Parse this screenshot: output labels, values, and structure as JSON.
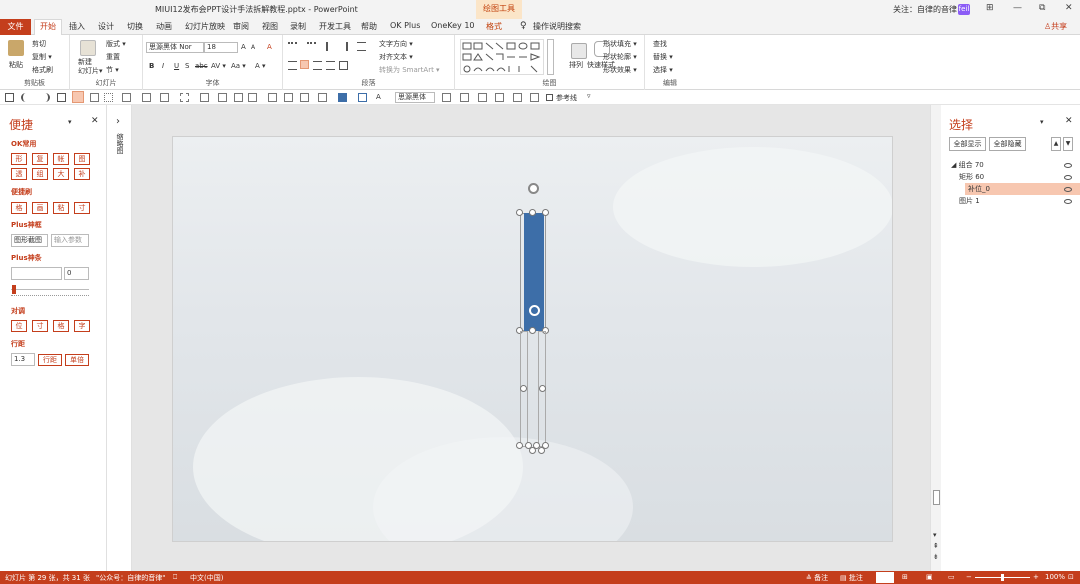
{
  "window": {
    "doc_title": "MIUI12发布会PPT设计手法拆解教程.pptx  -  PowerPoint",
    "context_tab_group": "绘图工具",
    "user": "关注：自律的音律",
    "user_badge": "feil",
    "minimize": "—",
    "restore": "⧉",
    "close": "✕",
    "ribbon_display": "⊞"
  },
  "tabs": {
    "file": "文件",
    "items": [
      "开始",
      "插入",
      "设计",
      "切换",
      "动画",
      "幻灯片放映",
      "审阅",
      "视图",
      "录制",
      "开发工具",
      "帮助",
      "OK Plus",
      "OneKey 10",
      "格式"
    ],
    "tell_me": "操作说明搜索",
    "share": "共享"
  },
  "ribbon": {
    "clipboard": {
      "label": "剪贴板",
      "paste": "粘贴",
      "cut": "剪切",
      "copy": "复制 ▾",
      "format_painter": "格式刷"
    },
    "slides": {
      "label": "幻灯片",
      "new_slide": "新建\n幻灯片▾",
      "layout": "版式 ▾",
      "reset": "重置",
      "section": "节 ▾"
    },
    "font": {
      "label": "字体",
      "font_name": "思源黑体 Nor",
      "font_size": "18",
      "grow": "A",
      "shrink": "A",
      "clear": "A",
      "bold": "B",
      "italic": "I",
      "underline": "U",
      "strike": "S",
      "shadow": "abc",
      "spacing": "AV ▾",
      "case": "Aa ▾",
      "color": "A ▾"
    },
    "paragraph": {
      "label": "段落",
      "text_direction": "文字方向 ▾",
      "align_text": "对齐文本 ▾",
      "smartart": "转换为 SmartArt ▾"
    },
    "drawing": {
      "label": "绘图",
      "arrange": "排列",
      "quick_styles": "快速样式",
      "shape_fill": "形状填充 ▾",
      "shape_outline": "形状轮廓 ▾",
      "shape_effects": "形状效果 ▾"
    },
    "editing": {
      "label": "编辑",
      "find": "查找",
      "replace": "替换 ▾",
      "select": "选择 ▾"
    }
  },
  "qat": {
    "font": "思源黑体",
    "gridlines": "参考线"
  },
  "left_panel": {
    "title": "便捷",
    "sec_ok": "OK常用",
    "ok_row1": [
      "形",
      "复",
      "帐",
      "图"
    ],
    "ok_row2": [
      "透",
      "组",
      "大",
      "补"
    ],
    "sec_convenient": "便捷刷",
    "conv_row": [
      "格",
      "画",
      "粘",
      "寸"
    ],
    "sec_plus_frame": "Plus神框",
    "frame_left": "图形截图",
    "frame_placeholder": "输入参数",
    "sec_plus_bar": "Plus神条",
    "bar_value": "0",
    "sec_align": "对调",
    "align_row": [
      "位",
      "寸",
      "格",
      "字"
    ],
    "sec_line": "行距",
    "line_value": "1.3",
    "line_btn1": "行距",
    "line_btn2": "单倍"
  },
  "thumbs": {
    "collapse": "›",
    "label": "缩略图"
  },
  "right_panel": {
    "title": "选择",
    "show_all": "全部显示",
    "hide_all": "全部隐藏",
    "items": [
      {
        "label": "组合 70",
        "level": 0,
        "selected": false
      },
      {
        "label": "矩形 60",
        "level": 1,
        "selected": false
      },
      {
        "label": "补位_0",
        "level": 1,
        "selected": true
      },
      {
        "label": "图片 1",
        "level": 0,
        "selected": false
      }
    ]
  },
  "status": {
    "slide_info": "幻灯片 第 29 张，共 31 张",
    "theme": "\"公众号：自律的音律\"",
    "lang": "中文(中国)",
    "notes": "≙ 备注",
    "comments": "▤ 批注",
    "zoom": "100%"
  },
  "colors": {
    "accent": "#c43e1c",
    "shape_fill": "#3d6ea8",
    "selected_item": "#f7c7b0"
  }
}
